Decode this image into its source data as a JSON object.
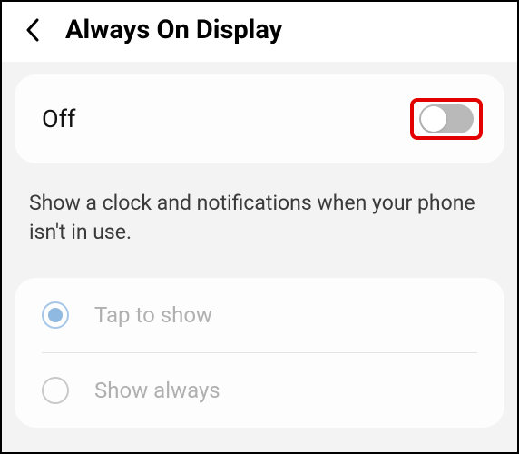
{
  "header": {
    "title": "Always On Display"
  },
  "toggle": {
    "label": "Off",
    "state": false,
    "highlighted": true
  },
  "description": "Show a clock and notifications when your phone isn't in use.",
  "options": [
    {
      "label": "Tap to show",
      "selected": true
    },
    {
      "label": "Show always",
      "selected": false
    }
  ]
}
